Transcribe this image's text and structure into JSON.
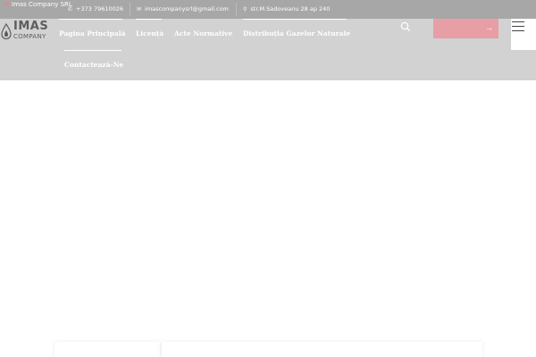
{
  "topbar": {
    "brand": "Imas Company SRL",
    "phone": "+373 79610026",
    "email": "imascompanysrl@gmail.com",
    "address": "str.M.Sadoveanu 28 ap 240"
  },
  "logo": {
    "line1": "IMAS",
    "line2": "COMPANY"
  },
  "nav": {
    "items": [
      {
        "label": "Pagina Principală"
      },
      {
        "label": "Licență"
      },
      {
        "label": "Acte Normative"
      },
      {
        "label": "Distribuția Gazelor Naturale"
      },
      {
        "label": "Contactează-Ne"
      }
    ]
  },
  "cta": {
    "arrow": "→"
  },
  "colors": {
    "topbar": "#a7a7a7",
    "header": "#d2d2d2",
    "accent": "#e89ea5"
  },
  "icons": [
    "phone-icon",
    "email-icon",
    "location-icon",
    "search-icon",
    "menu-icon",
    "arrow-right-icon"
  ]
}
